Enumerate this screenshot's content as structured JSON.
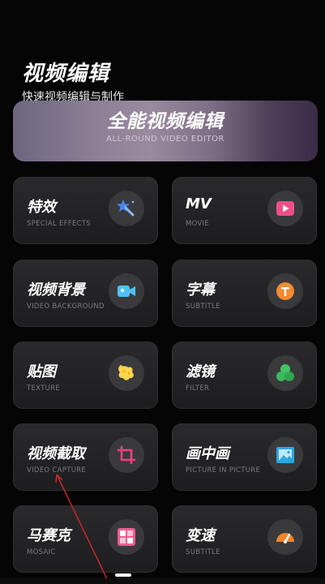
{
  "header": {
    "title": "视频编辑",
    "subtitle": "快速视频编辑与制作"
  },
  "banner": {
    "title": "全能视频编辑",
    "subtitle": "ALL-ROUND VIDEO EDITOR"
  },
  "features": [
    {
      "label": "特效",
      "en": "SPECIAL EFFECTS",
      "icon": "magic-wand-icon"
    },
    {
      "label": "MV",
      "en": "MOVIE",
      "icon": "play-icon"
    },
    {
      "label": "视频背景",
      "en": "VIDEO BACKGROUND",
      "icon": "video-camera-icon"
    },
    {
      "label": "字幕",
      "en": "SUBTITLE",
      "icon": "text-t-icon"
    },
    {
      "label": "贴图",
      "en": "TEXTURE",
      "icon": "sticker-icon"
    },
    {
      "label": "滤镜",
      "en": "FILTER",
      "icon": "filter-circles-icon"
    },
    {
      "label": "视频截取",
      "en": "VIDEO CAPTURE",
      "icon": "crop-icon"
    },
    {
      "label": "画中画",
      "en": "PICTURE IN PICTURE",
      "icon": "image-icon"
    },
    {
      "label": "马赛克",
      "en": "MOSAIC",
      "icon": "mosaic-icon"
    },
    {
      "label": "变速",
      "en": "SUBTITLE",
      "icon": "speedometer-icon"
    }
  ],
  "colors": {
    "background": "#050505",
    "card": "#232325",
    "icon_bg": "#3a3a3d",
    "annotation_arrow": "#c62828"
  }
}
